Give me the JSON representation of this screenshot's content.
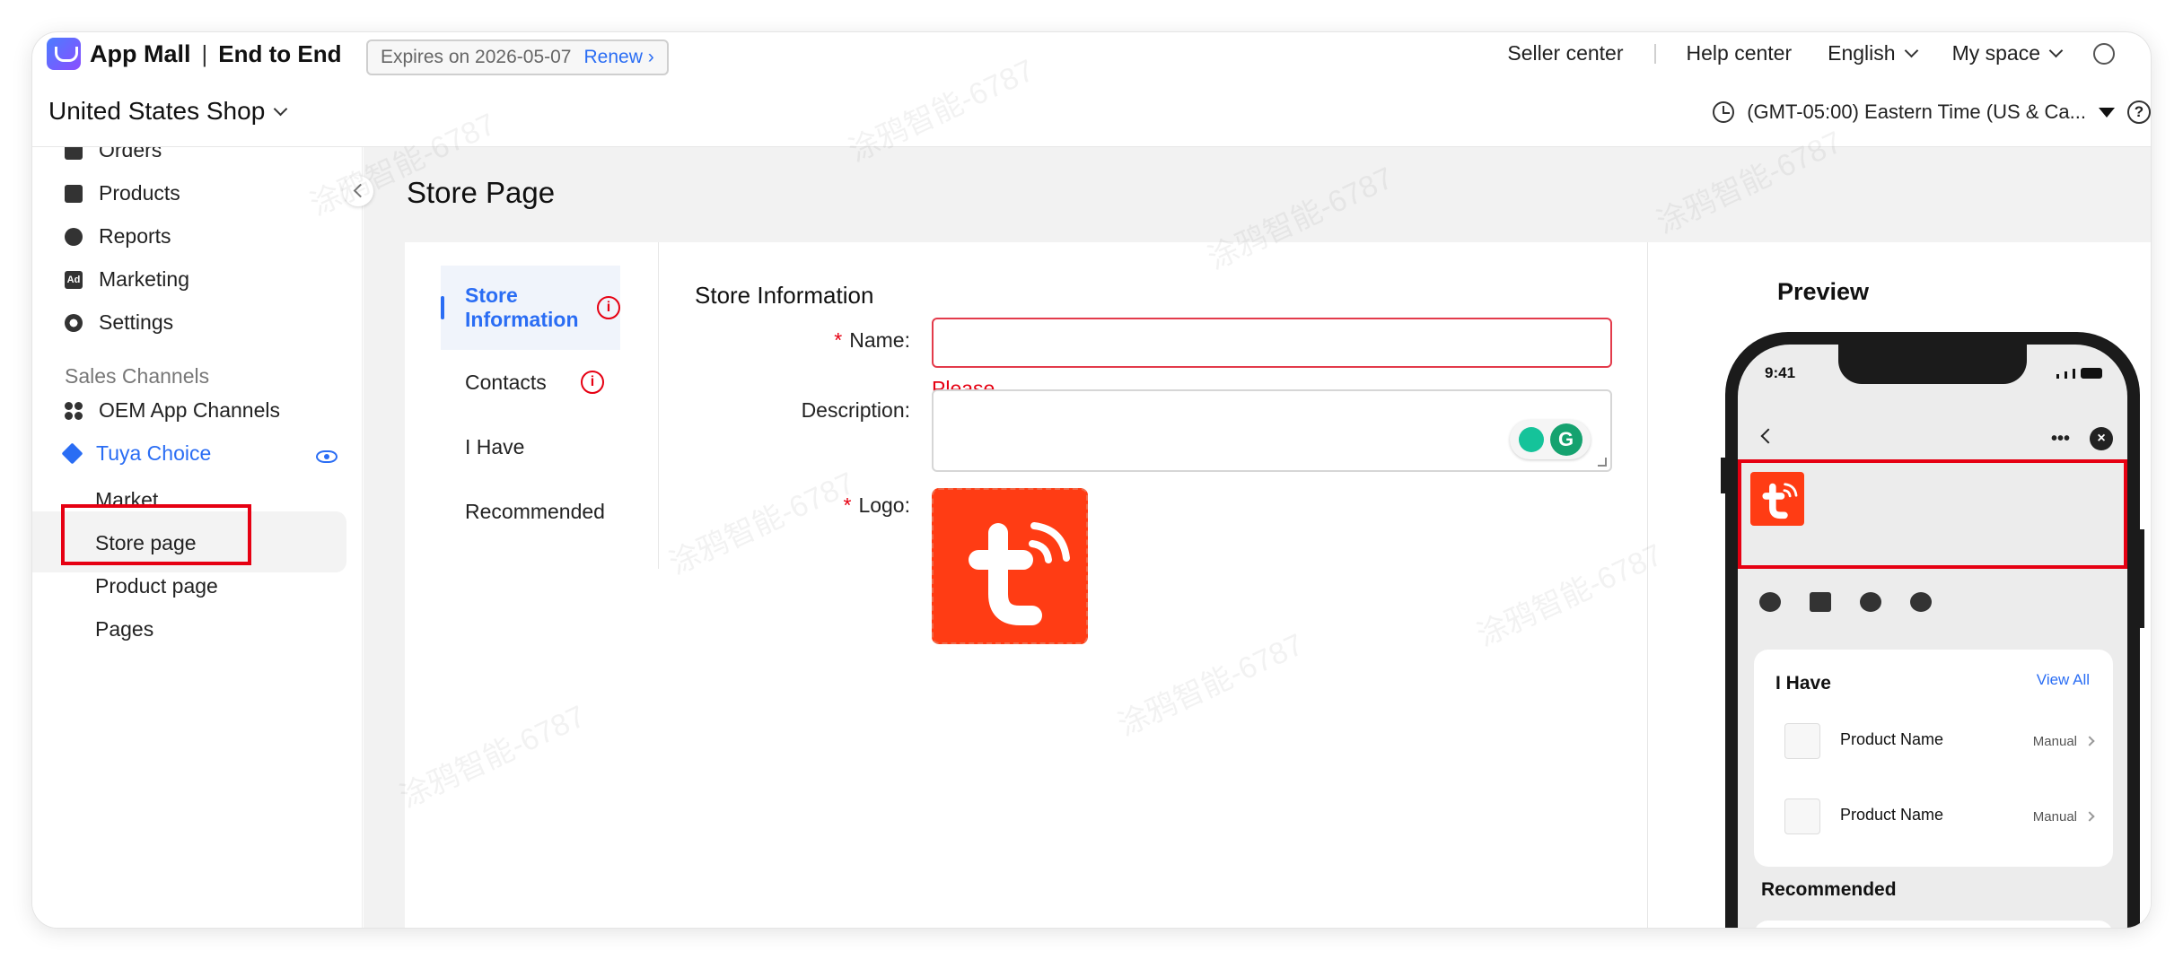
{
  "header": {
    "brand": "App Mall",
    "brand_separator": "|",
    "brand_sub": "End to End",
    "expires_text": "Expires on 2026-05-07",
    "renew_label": "Renew",
    "nav": {
      "seller_center": "Seller center",
      "help_center": "Help center",
      "language": "English",
      "my_space": "My space"
    },
    "shop_name": "United States Shop",
    "timezone": "(GMT-05:00) Eastern Time (US & Ca..."
  },
  "sidebar": {
    "items": [
      {
        "label": "Orders"
      },
      {
        "label": "Products"
      },
      {
        "label": "Reports"
      },
      {
        "label": "Marketing"
      },
      {
        "label": "Settings"
      }
    ],
    "section_label": "Sales Channels",
    "channels": [
      {
        "label": "OEM App Channels"
      },
      {
        "label": "Tuya Choice"
      }
    ],
    "sub_items": [
      {
        "label": "Market"
      },
      {
        "label": "Store page"
      },
      {
        "label": "Product page"
      },
      {
        "label": "Pages"
      }
    ]
  },
  "main": {
    "page_title": "Store Page",
    "tabs": [
      {
        "label": "Store Information"
      },
      {
        "label": "Contacts"
      },
      {
        "label": "I Have"
      },
      {
        "label": "Recommended"
      }
    ],
    "form": {
      "title": "Store Information",
      "name_label": "Name",
      "name_error": "Please enter Name",
      "description_label": "Description",
      "logo_label": "Logo",
      "required_mark": "*",
      "colon": ":"
    }
  },
  "preview": {
    "title": "Preview",
    "time": "9:41",
    "more": "•••",
    "close": "×",
    "i_have_title": "I Have",
    "view_all": "View All",
    "products": [
      {
        "name": "Product Name",
        "tag": "Manual"
      },
      {
        "name": "Product Name",
        "tag": "Manual"
      }
    ],
    "recommended_title": "Recommended"
  },
  "watermark": "涂鸦智能-6787",
  "colors": {
    "accent": "#2a6df4",
    "error": "#e60012",
    "logo_bg": "#ff3c14"
  }
}
